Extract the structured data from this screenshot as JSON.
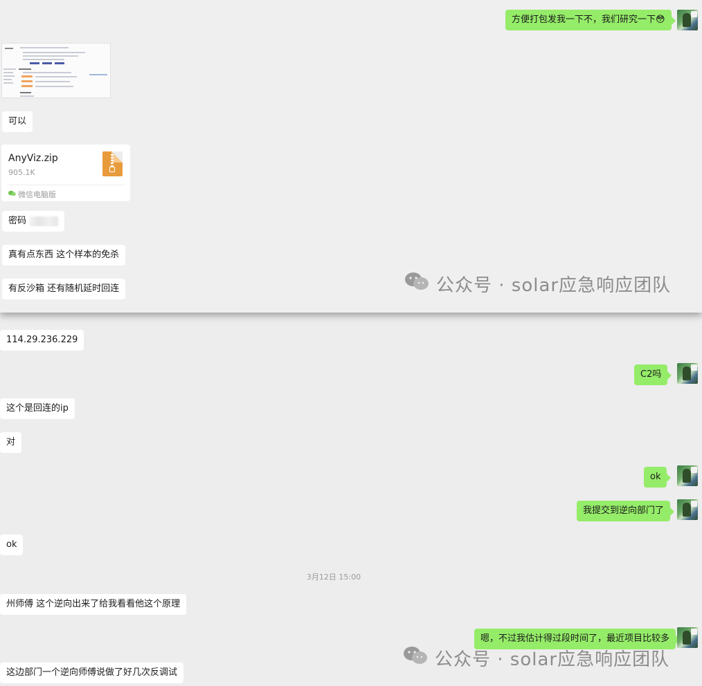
{
  "top_panel": {
    "messages": {
      "out_1": "方便打包发我一下不，我们研究一下😳",
      "in_ok": "可以",
      "in_password": "密码",
      "in_sample": "真有点东西 这个样本的免杀",
      "in_sandbox": "有反沙箱 还有随机延时回连"
    },
    "file": {
      "name": "AnyViz.zip",
      "size": "905.1K",
      "source": "微信电脑版",
      "icon": "zip-file-icon"
    },
    "watermark": "公众号 · solar应急响应团队"
  },
  "chat": {
    "in_ip": "114.29.236.229",
    "out_c2": "C2吗",
    "in_callback": "这个是回连的ip",
    "in_yes": "对",
    "out_ok": "ok",
    "out_handed": "我提交到逆向部门了",
    "in_ok": "ok",
    "timestamp": "3月12日 15:00",
    "in_master": "州师傅 这个逆向出来了给我看看他这个原理",
    "out_busy": "嗯，不过我估计得过段时间了，最近项目比较多",
    "in_dept": "这边部门一个逆向师傅说做了好几次反调试"
  },
  "watermark": "公众号 · solar应急响应团队",
  "colors": {
    "outgoing_bubble": "#95ec69",
    "incoming_bubble": "#ffffff",
    "background": "#ededed",
    "zip_icon": "#e89b3c"
  }
}
